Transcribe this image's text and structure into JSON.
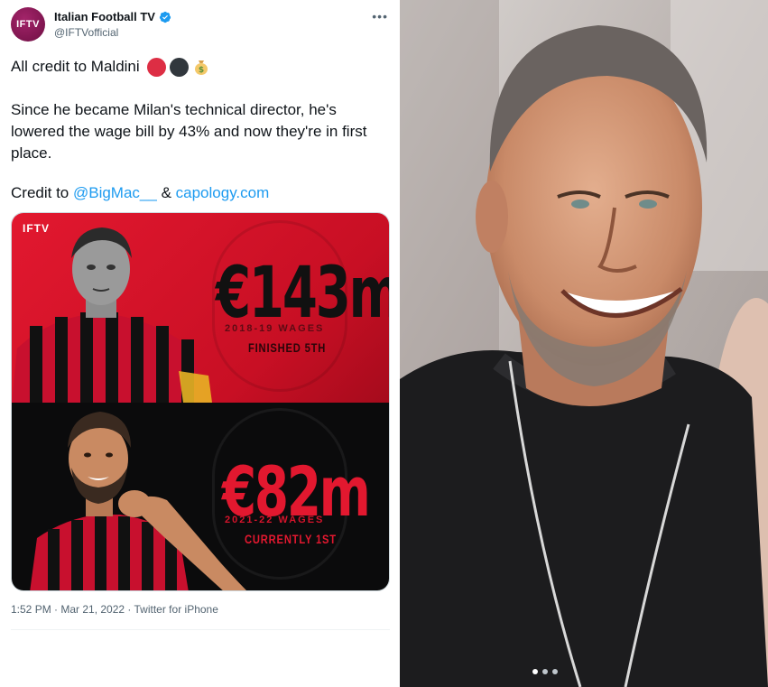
{
  "tweet": {
    "avatar_text": "IFTV",
    "display_name": "Italian Football TV",
    "handle": "@IFTVofficial",
    "line1": "All credit to Maldini",
    "line2": "Since he became Milan's technical director, he's lowered the wage bill by 43% and now they're in first place.",
    "line3_prefix": "Credit to ",
    "mention": "@BigMac__",
    "amp": " & ",
    "site_link": "capology.com",
    "meta": "1:52 PM · Mar 21, 2022 · Twitter for iPhone",
    "emojis": [
      "red-circle-icon",
      "black-circle-icon",
      "money-bag-icon"
    ]
  },
  "card": {
    "logo": "IFTV",
    "top": {
      "amount": "€143m",
      "label": "2018-19 WAGES",
      "status": "FINISHED 5TH"
    },
    "bottom": {
      "amount": "€82m",
      "label": "2021-22 WAGES",
      "status": "CURRENTLY 1ST"
    }
  },
  "carousel": {
    "pages": 3,
    "active": 1
  },
  "colors": {
    "accent_red": "#e2182f",
    "link": "#1d9bf0",
    "secondary_text": "#536471"
  }
}
